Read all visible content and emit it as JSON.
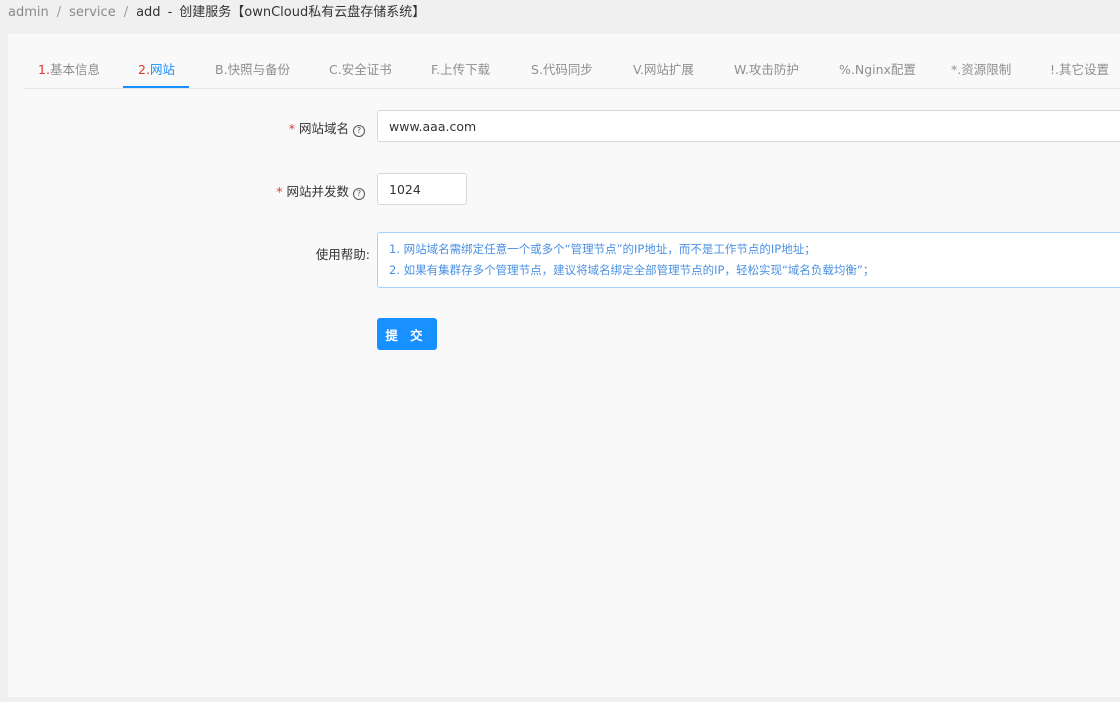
{
  "breadcrumb": {
    "items": [
      "admin",
      "service"
    ],
    "current": "add",
    "title": "创建服务【ownCloud私有云盘存储系统】"
  },
  "tabs": [
    {
      "prefix": "1.",
      "label": "基本信息"
    },
    {
      "prefix": "2.",
      "label": "网站"
    },
    {
      "prefix": "B.",
      "label": "快照与备份"
    },
    {
      "prefix": "C.",
      "label": "安全证书"
    },
    {
      "prefix": "F.",
      "label": "上传下载"
    },
    {
      "prefix": "S.",
      "label": "代码同步"
    },
    {
      "prefix": "V.",
      "label": "网站扩展"
    },
    {
      "prefix": "W.",
      "label": "攻击防护"
    },
    {
      "prefix": "%.",
      "label": "Nginx配置"
    },
    {
      "prefix": "*.",
      "label": "资源限制"
    },
    {
      "prefix": "!.",
      "label": "其它设置"
    }
  ],
  "active_tab": "2.网站",
  "form": {
    "domain": {
      "required_mark": "*",
      "label": "网站域名",
      "value": "www.aaa.com"
    },
    "concurrency": {
      "required_mark": "*",
      "label": "网站并发数",
      "value": "1024"
    },
    "help": {
      "label": "使用帮助:",
      "lines": [
        "1. 网站域名需绑定任意一个或多个“管理节点”的IP地址，而不是工作节点的IP地址；",
        "2. 如果有集群存多个管理节点，建议将域名绑定全部管理节点的IP，轻松实现“域名负载均衡”；"
      ]
    },
    "submit_label": "提 交"
  },
  "icons": {
    "help": "question-circle-icon"
  },
  "colors": {
    "accent": "#1890ff",
    "required": "#e8352e",
    "help_text": "#4a90e2"
  }
}
